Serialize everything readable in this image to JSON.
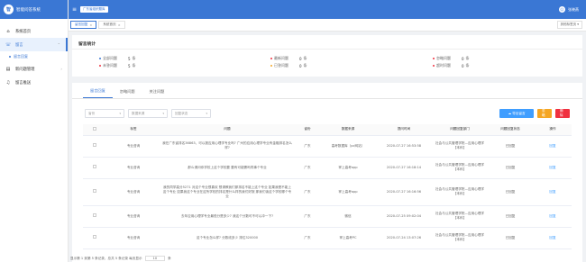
{
  "app": {
    "title": "智能问答系统",
    "logo_text": "智"
  },
  "topbar": {
    "unit": "广东省组织题库",
    "user": "张晓燕"
  },
  "sidebar": {
    "items": [
      {
        "label": "系统首页",
        "icon": "home-icon",
        "glyph": "⌂"
      },
      {
        "label": "留言",
        "icon": "chat-icon",
        "glyph": "☏",
        "active": true,
        "arrow": "⌃"
      },
      {
        "label": "留言回复",
        "sub": true
      },
      {
        "label": "新问题管理",
        "icon": "book-icon",
        "glyph": "▤",
        "arrow": "›"
      },
      {
        "label": "留言推送",
        "icon": "headset-icon",
        "glyph": "♫"
      }
    ]
  },
  "tabs": [
    {
      "label": "留言回复",
      "active": true
    },
    {
      "label": "系统首页",
      "active": false
    }
  ],
  "tabs_more": "其他标签页 ▾",
  "stats": {
    "title": "留言统计",
    "items": [
      {
        "label": "全部问题",
        "value": "5",
        "unit": "条",
        "color": "#3a77d4"
      },
      {
        "label": "未答问题",
        "value": "5",
        "unit": "条",
        "color": "#f0303f"
      },
      {
        "label": "最新问题",
        "value": "0",
        "unit": "条",
        "color": "#f0303f"
      },
      {
        "label": "已答问题",
        "value": "0",
        "unit": "条",
        "color": "#f5a623"
      },
      {
        "label": "忽略问题",
        "value": "0",
        "unit": "条",
        "color": "#f0303f"
      },
      {
        "label": "超时问题",
        "value": "0",
        "unit": "条",
        "color": "#f0303f"
      }
    ]
  },
  "inner_tabs": [
    "留言回复",
    "忽略问题",
    "关注问题"
  ],
  "filters": [
    "省份",
    "数据来源",
    "回复状态"
  ],
  "buttons": {
    "export": "导出留言",
    "ignore": "忽略",
    "delete": "删除"
  },
  "table": {
    "headers": [
      "",
      "标签",
      "问题",
      "省份",
      "数据来源",
      "提问时间",
      "问题回复部门",
      "问题回复状态",
      "操作"
    ],
    "rows": [
      {
        "tag": "专业咨询",
        "question": "我在广东省排名36863，可以报应用心理学专业吗? 广州的应用心理学专业有金融排名怎么样?",
        "province": "广东",
        "source": "高考数据库（pc网站）",
        "time": "2020-07-27 16:53:58",
        "dept": "社会与公共管理学院—应用心理学【本科】",
        "status": "已回复",
        "op": "回复"
      },
      {
        "tag": "专业咨询",
        "question": "那么请问你学校上这个学校要 要有可能需吗同事个专业",
        "province": "广东",
        "source": "掌上高考app",
        "time": "2020-07-27 16:18:14",
        "dept": "社会与公共管理学院—应用心理学【本科】",
        "status": "已回复",
        "op": "回复"
      },
      {
        "tag": "专业咨询",
        "question": "我的同学高分5271 对这个专业很喜欢 想请教我们那排名不能上这个专业 如果我是不能上这个专业 如果我这个专业在这所学校的排名是什么样的我们好报 那我们读这个学校哪个专业",
        "province": "广东",
        "source": "掌上高考app",
        "time": "2020-07-27 16:16:56",
        "dept": "社会与公共管理学院—应用心理学【本科】",
        "status": "已回复",
        "op": "回复"
      },
      {
        "tag": "专业咨询",
        "question": "去年应用心理学专业最低分是多少? 我这个分数可不可以冲一下?",
        "province": "广东",
        "source": "微信",
        "time": "2020-07-25 09:02:04",
        "dept": "社会与公共管理学院—应用心理学【本科】",
        "status": "已回复",
        "op": "回复"
      },
      {
        "tag": "专业咨询",
        "question": "这个专业怎么样? 分数线多少 排位320000",
        "province": "广东",
        "source": "掌上高考PC",
        "time": "2020-07-24 13:07:26",
        "dept": "社会与公共管理学院—应用心理学【本科】",
        "status": "已回复",
        "op": "回复"
      }
    ]
  },
  "footer": {
    "text": "显示第 1 到第 5 条记录，总共 5 条记录 每页显示",
    "page_size": "10",
    "suffix": "条"
  }
}
